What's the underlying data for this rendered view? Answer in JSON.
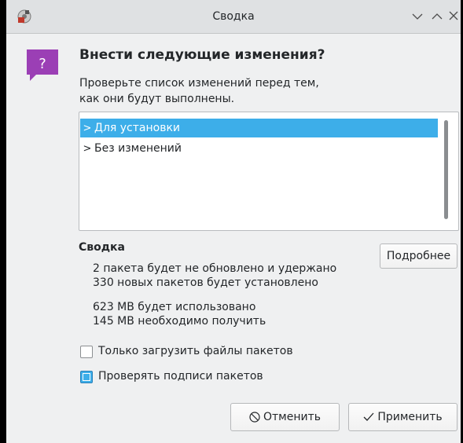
{
  "window": {
    "title": "Сводка",
    "controls": [
      "minimize-icon",
      "maximize-icon",
      "close-icon"
    ]
  },
  "dialog": {
    "icon": "question-icon",
    "heading": "Внести следующие изменения?",
    "description": "Проверьте список изменений перед тем, как они будут выполнены."
  },
  "tree": {
    "items": [
      {
        "label": "Для установки",
        "selected": true
      },
      {
        "label": "Без изменений",
        "selected": false
      }
    ]
  },
  "summary": {
    "heading": "Сводка",
    "details_button": "Подробнее",
    "lines": [
      "2 пакета будет не обновлено и удержано",
      "330 новых пакетов будет установлено",
      "623 MB будет использовано",
      "145 MB необходимо получить"
    ]
  },
  "options": [
    {
      "label": "Только загрузить файлы пакетов",
      "checked": false
    },
    {
      "label": "Проверять подписи пакетов",
      "checked": true
    }
  ],
  "buttons": {
    "cancel": "Отменить",
    "apply": "Применить"
  },
  "colors": {
    "accent": "#3daee9",
    "icon_purple": "#9b3fb5"
  }
}
